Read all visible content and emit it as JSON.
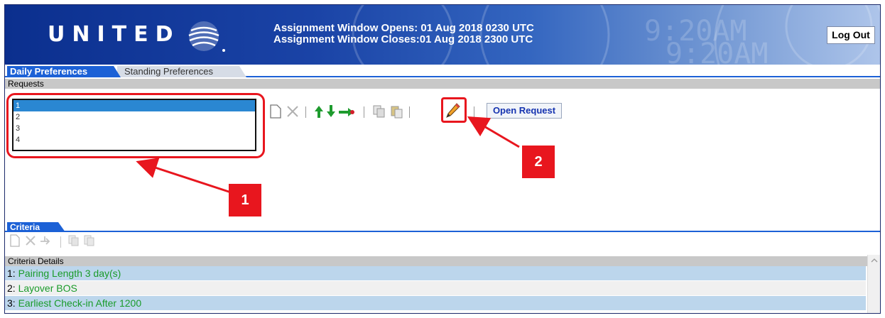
{
  "header": {
    "logo_text": "UNITED",
    "assignment_opens": "Assignment Window Opens: 01 Aug 2018 0230 UTC",
    "assignment_closes": "Assignment Window Closes:01 Aug 2018 2300 UTC",
    "logout_label": "Log Out",
    "background_digits": "9:20AM"
  },
  "tabs": [
    {
      "label": "Daily Preferences",
      "active": true
    },
    {
      "label": "Standing Preferences",
      "active": false
    }
  ],
  "requests": {
    "section_label": "Requests",
    "items": [
      "1",
      "2",
      "3",
      "4"
    ],
    "selected_index": 0
  },
  "toolbar": {
    "icons": [
      "new-document-icon",
      "delete-x-icon",
      "move-up-arrow-icon",
      "move-down-arrow-icon",
      "move-right-arrow-icon",
      "copy-icon",
      "paste-icon",
      "pencil-edit-icon"
    ],
    "open_request_label": "Open Request"
  },
  "annotations": {
    "badge_1": "1",
    "badge_2": "2",
    "color": "#e8161e"
  },
  "criteria": {
    "tab_label": "Criteria",
    "details_label": "Criteria Details",
    "rows": [
      {
        "num": "1: ",
        "text": "Pairing Length 3 day(s)"
      },
      {
        "num": "2: ",
        "text": "Layover BOS"
      },
      {
        "num": "3: ",
        "text": "Earliest Check-in After 1200"
      }
    ]
  },
  "colors": {
    "accent_blue": "#1c61d6",
    "selected_row": "#2a87d2",
    "criteria_text": "#1a9b2a",
    "row_alt": "#bcd6ec"
  }
}
